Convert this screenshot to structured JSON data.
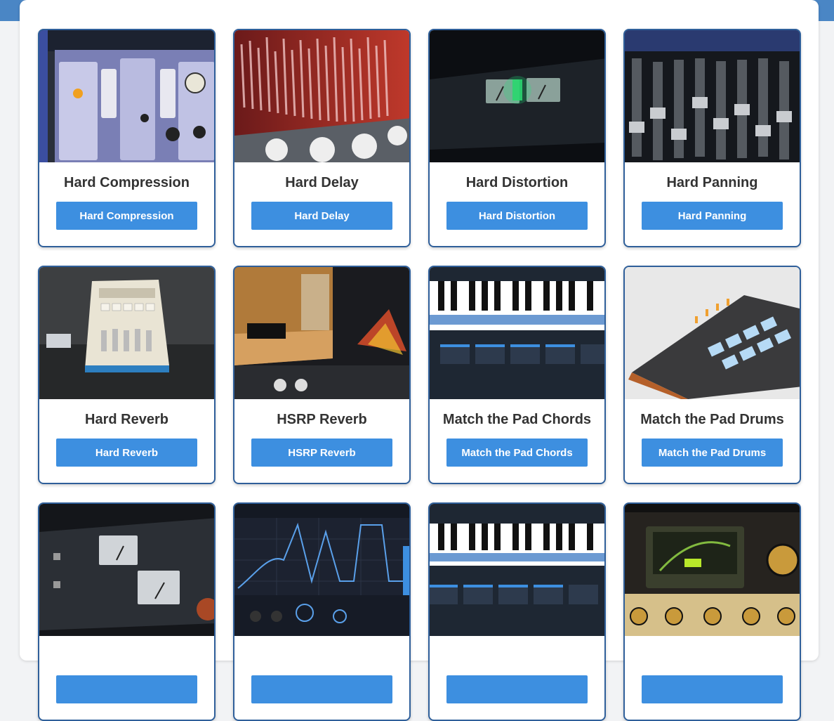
{
  "cards": [
    {
      "title": "Hard Compression",
      "button": "Hard Compression",
      "image": "compressor-plugin-image"
    },
    {
      "title": "Hard Delay",
      "button": "Hard Delay",
      "image": "delay-plugin-image"
    },
    {
      "title": "Hard Distortion",
      "button": "Hard Distortion",
      "image": "distortion-hardware-image"
    },
    {
      "title": "Hard Panning",
      "button": "Hard Panning",
      "image": "mixing-console-image"
    },
    {
      "title": "Hard Reverb",
      "button": "Hard Reverb",
      "image": "reverb-unit-image"
    },
    {
      "title": "HSRP Reverb",
      "button": "HSRP Reverb",
      "image": "concert-hall-reverb-image"
    },
    {
      "title": "Match the Pad Chords",
      "button": "Match the Pad Chords",
      "image": "piano-chords-plugin-image"
    },
    {
      "title": "Match the Pad Drums",
      "button": "Match the Pad Drums",
      "image": "drum-pad-controller-image"
    },
    {
      "title": "",
      "button": "",
      "image": "vu-meter-rack-image"
    },
    {
      "title": "",
      "button": "",
      "image": "envelope-plugin-image"
    },
    {
      "title": "",
      "button": "",
      "image": "piano-chords-plugin-image-2"
    },
    {
      "title": "",
      "button": "",
      "image": "tape-saturation-plugin-image"
    }
  ],
  "colors": {
    "accent": "#3d8fe0",
    "card_border": "#2f5f9a",
    "header_band": "#4a86c5"
  }
}
